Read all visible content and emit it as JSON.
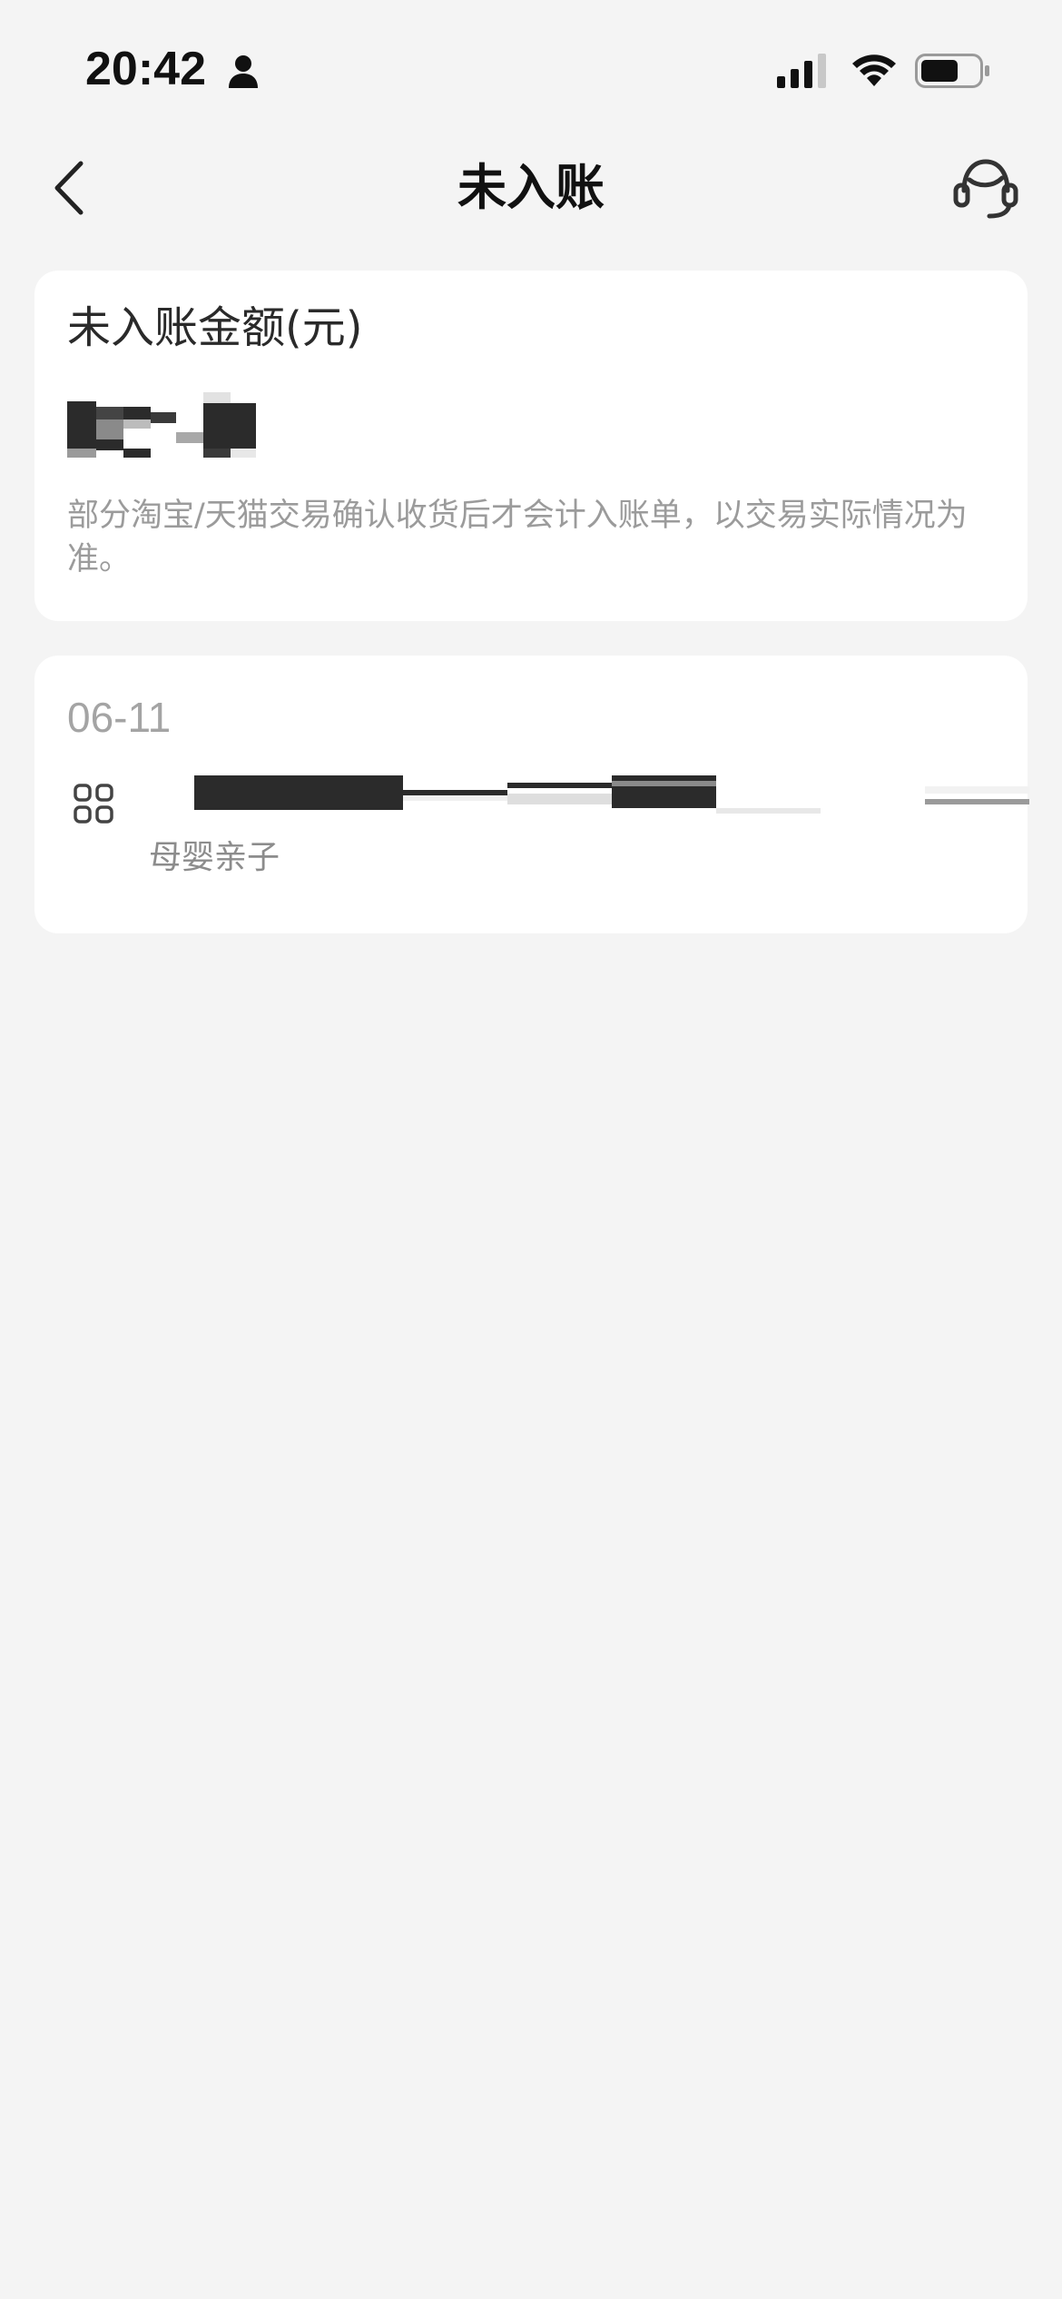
{
  "status_bar": {
    "time": "20:42",
    "icons": [
      "person-icon",
      "cellular-signal-icon",
      "wifi-icon",
      "battery-icon"
    ]
  },
  "nav": {
    "title": "未入账",
    "back_icon": "chevron-left-icon",
    "service_icon": "customer-service-headset-icon"
  },
  "summary": {
    "label": "未入账金额(元)",
    "amount_obscured": true,
    "note": "部分淘宝/天猫交易确认收货后才会计入账单，以交易实际情况为准。"
  },
  "records": {
    "date": "06-11",
    "items": [
      {
        "icon": "grid-four-squares-icon",
        "title_obscured": true,
        "category": "母婴亲子"
      }
    ]
  },
  "colors": {
    "background": "#f4f4f4",
    "card": "#ffffff",
    "primary_text": "#1f1f1f",
    "secondary_text": "#9b9b9b"
  }
}
